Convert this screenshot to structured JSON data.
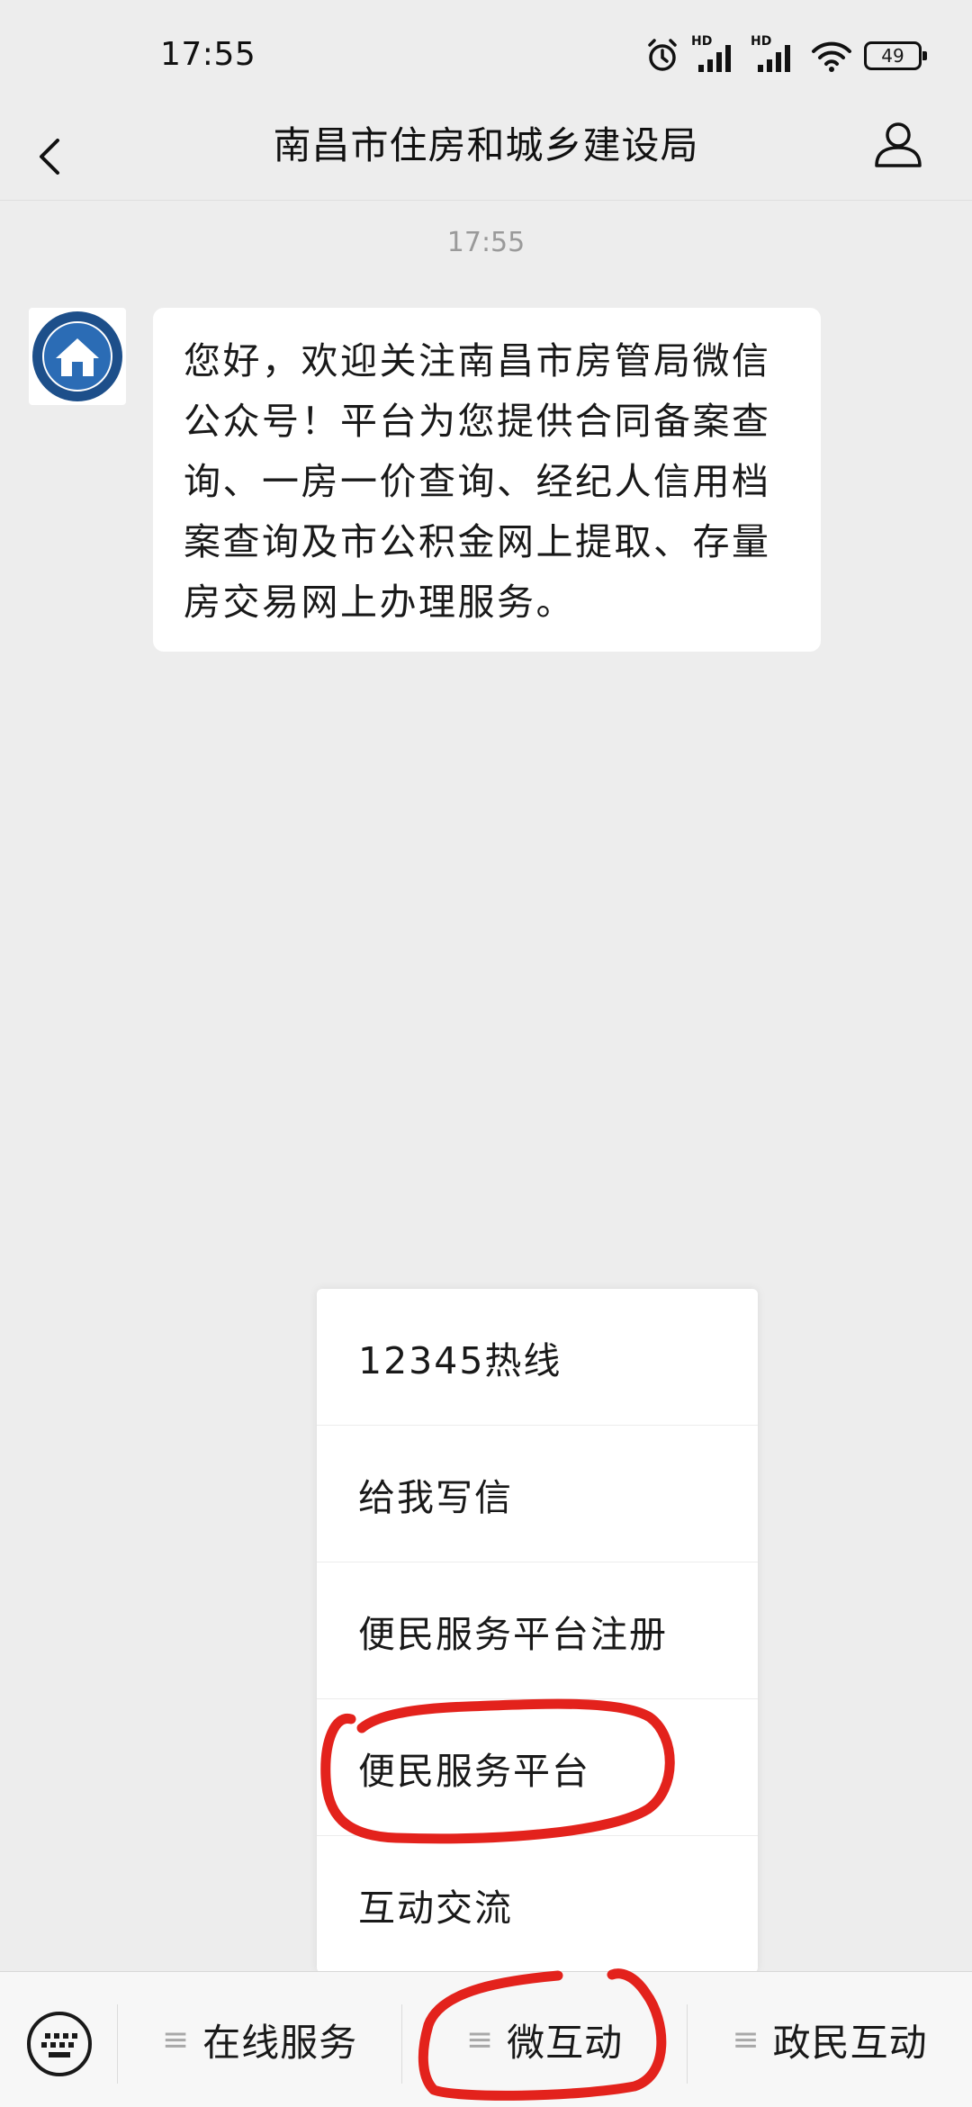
{
  "status_bar": {
    "time": "17:55",
    "battery": "49",
    "signal_label_1": "HD",
    "signal_label_2": "HD"
  },
  "nav": {
    "title": "南昌市住房和城乡建设局"
  },
  "chat": {
    "timestamp": "17:55",
    "message": "您好，欢迎关注南昌市房管局微信公众号！平台为您提供合同备案查询、一房一价查询、经纪人信用档案查询及市公积金网上提取、存量房交易网上办理服务。"
  },
  "popup_menu": {
    "items": [
      {
        "label": "12345热线"
      },
      {
        "label": "给我写信"
      },
      {
        "label": "便民服务平台注册"
      },
      {
        "label": "便民服务平台"
      },
      {
        "label": "互动交流"
      }
    ]
  },
  "bottom_menu": {
    "tabs": [
      {
        "label": "在线服务"
      },
      {
        "label": "微互动"
      },
      {
        "label": "政民互动"
      }
    ]
  },
  "icons": {
    "back": "chevron-left-icon",
    "profile": "person-icon",
    "keyboard": "keyboard-icon",
    "menu": "list-icon",
    "alarm": "alarm-clock-icon",
    "signal": "signal-icon",
    "wifi": "wifi-icon",
    "battery": "battery-icon"
  },
  "colors": {
    "background": "#ededed",
    "bubble": "#ffffff",
    "annotation": "#e3221c"
  }
}
